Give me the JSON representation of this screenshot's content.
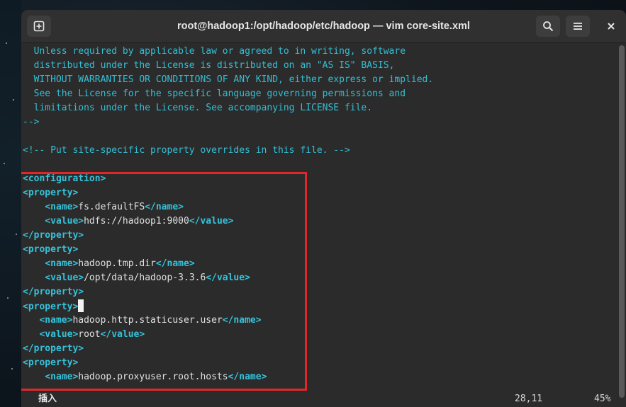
{
  "window": {
    "title": "root@hadoop1:/opt/hadoop/etc/hadoop — vim core-site.xml"
  },
  "titlebar_icons": {
    "new_tab": "new-tab-icon",
    "search": "search-icon",
    "menu": "hamburger-menu-icon",
    "close": "close-icon"
  },
  "editor": {
    "license_lines": [
      "  Unless required by applicable law or agreed to in writing, software",
      "  distributed under the License is distributed on an \"AS IS\" BASIS,",
      "  WITHOUT WARRANTIES OR CONDITIONS OF ANY KIND, either express or implied.",
      "  See the License for the specific language governing permissions and",
      "  limitations under the License. See accompanying LICENSE file."
    ],
    "comment_close": "-->",
    "site_comment": "<!-- Put site-specific property overrides in this file. -->",
    "config_open": "<configuration>",
    "property_open": "<property>",
    "property_close": "</property>",
    "name_open": "<name>",
    "name_close": "</name>",
    "value_open": "<value>",
    "value_close": "</value>",
    "properties": [
      {
        "name": "fs.defaultFS",
        "value": "hdfs://hadoop1:9000"
      },
      {
        "name": "hadoop.tmp.dir",
        "value": "/opt/data/hadoop-3.3.6"
      },
      {
        "name": "hadoop.http.staticuser.user",
        "value": "root"
      },
      {
        "name": "hadoop.proxyuser.root.hosts"
      }
    ]
  },
  "status": {
    "mode": "插入",
    "position": "28,11",
    "percent": "45%"
  },
  "colors": {
    "comment": "#34bfd5",
    "tag": "#35c2db",
    "highlight_box": "#e3262b",
    "background": "#2b2b2b"
  }
}
